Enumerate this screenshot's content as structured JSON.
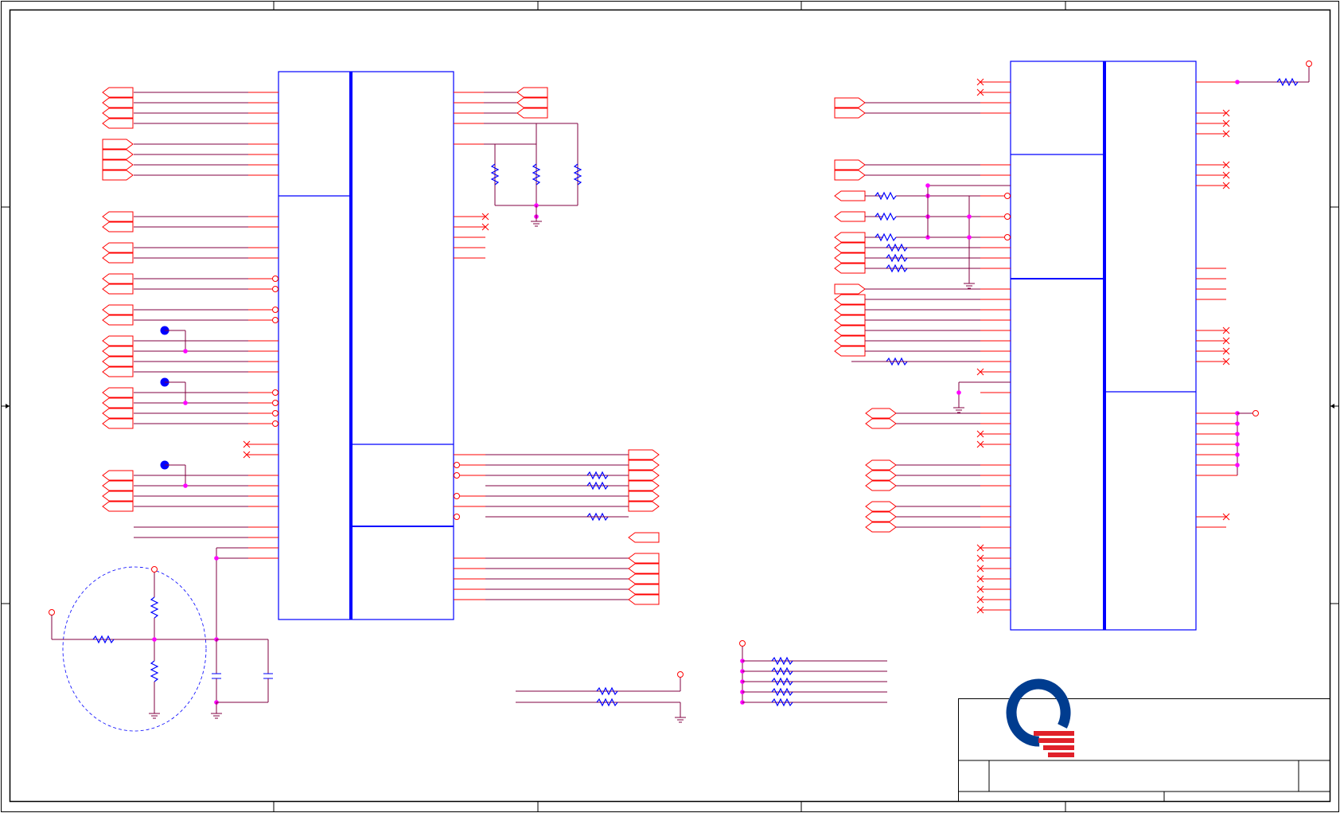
{
  "sheet": {
    "title_block": {
      "company_logo": "quanta-logo-icon",
      "logo_colors": {
        "ring": "#003c8f",
        "stripes": "#e0202a"
      }
    },
    "colors": {
      "frame": "#000000",
      "wire": "#800040",
      "pin": "#ff0000",
      "component": "#0000ff",
      "junction": "#ff00ff",
      "background": "#ffffff"
    }
  }
}
